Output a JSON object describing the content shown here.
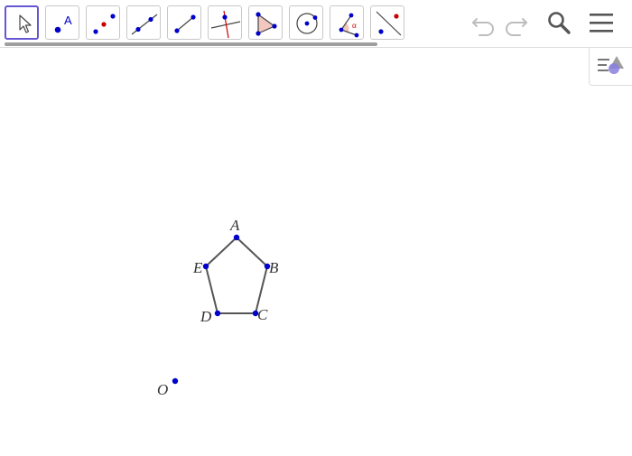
{
  "toolbar": {
    "tools": [
      {
        "name": "move-tool",
        "selected": true
      },
      {
        "name": "point-tool",
        "glyph": "A"
      },
      {
        "name": "two-points-tool"
      },
      {
        "name": "line-tool"
      },
      {
        "name": "segment-tool"
      },
      {
        "name": "perpendicular-line-tool"
      },
      {
        "name": "polygon-tool"
      },
      {
        "name": "circle-center-point-tool"
      },
      {
        "name": "angle-tool",
        "glyph": "α"
      },
      {
        "name": "reflect-about-line-tool"
      }
    ],
    "right_buttons": [
      "undo-icon",
      "redo-icon",
      "search-icon",
      "menu-icon"
    ]
  },
  "style_bar": {
    "icon": "style-bar-toggle-icon"
  },
  "graphics": {
    "polygon": {
      "name": "pentagon",
      "vertices": [
        "A",
        "B",
        "C",
        "D",
        "E"
      ]
    },
    "points": {
      "A": {
        "label": "A"
      },
      "B": {
        "label": "B"
      },
      "C": {
        "label": "C"
      },
      "D": {
        "label": "D"
      },
      "E": {
        "label": "E"
      },
      "O": {
        "label": "O"
      }
    }
  },
  "colors": {
    "accent": "#6557d2",
    "point": "#0000cc",
    "segment": "#555555",
    "icon_red": "#cc0000",
    "polygon_icon_fill": "#f1c7c0",
    "disabled": "#bdbdbd",
    "icon_dark": "#555555"
  }
}
